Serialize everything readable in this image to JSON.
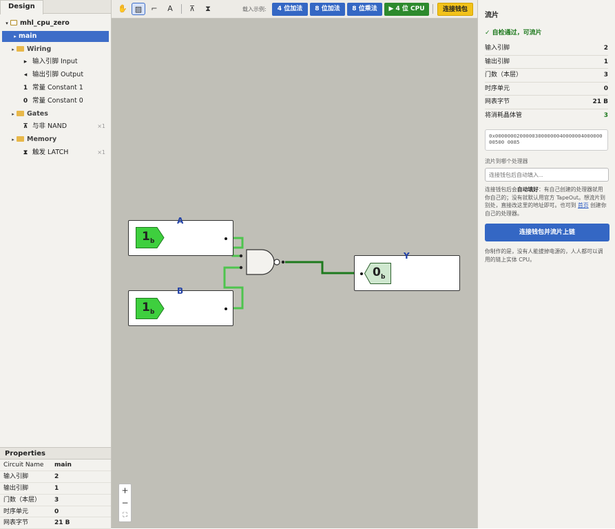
{
  "left": {
    "tab": "Design",
    "project": "mhl_cpu_zero",
    "tree": {
      "main": "main",
      "wiring": "Wiring",
      "input": "输入引脚 Input",
      "output": "输出引脚 Output",
      "const1_icon": "1",
      "const1": "常量 Constant 1",
      "const0_icon": "0",
      "const0": "常量 Constant 0",
      "gates": "Gates",
      "nand": "与非 NAND",
      "nand_count": "×1",
      "memory": "Memory",
      "latch": "触发 LATCH",
      "latch_count": "×1"
    },
    "properties": {
      "title": "Properties",
      "rows": [
        {
          "k": "Circuit Name",
          "v": "main"
        },
        {
          "k": "输入引脚",
          "v": "2"
        },
        {
          "k": "输出引脚",
          "v": "1"
        },
        {
          "k": "门数（本层）",
          "v": "3"
        },
        {
          "k": "时序单元",
          "v": "0"
        },
        {
          "k": "网表字节",
          "v": "21 B"
        }
      ]
    }
  },
  "toolbar": {
    "tool_text": "A",
    "load_label": "载入示例:",
    "examples": [
      "4 位加法",
      "8 位加法",
      "8 位乘法",
      "▶ 4 位 CPU"
    ],
    "connect": "连接钱包"
  },
  "circuit": {
    "input_a_label": "A",
    "input_a_value": "1",
    "input_a_sub": "b",
    "input_b_label": "B",
    "input_b_value": "1",
    "input_b_sub": "b",
    "output_y_label": "Y",
    "output_y_value": "0",
    "output_y_sub": "b"
  },
  "zoom": {
    "in": "+",
    "out": "−",
    "fit": "⛶"
  },
  "right": {
    "title": "流片",
    "status": "✓ 自检通过，可流片",
    "stats": [
      {
        "k": "输入引脚",
        "v": "2"
      },
      {
        "k": "输出引脚",
        "v": "1"
      },
      {
        "k": "门数（本层）",
        "v": "3"
      },
      {
        "k": "时序单元",
        "v": "0"
      },
      {
        "k": "网表字节",
        "v": "21 B"
      },
      {
        "k": "将消耗晶体管",
        "v": "3"
      }
    ],
    "hex": "0x0000000200000300000004000000400000000500 0085",
    "processor_label": "流片到哪个处理器",
    "processor_placeholder": "连接钱包后自动填入...",
    "para1_a": "连接钱包后会",
    "para1_b": "自动填好",
    "para1_c": "：有自己创建的处理器就用你自己的；没有就默认用官方 TapeOut。想流片到别处，直接改这里的地址即可。也可到",
    "para1_link": "首页",
    "para1_d": "创建你自己的处理器。",
    "button": "连接钱包并流片上链",
    "para2": "你制作的是，没有人能拔掉电源的，人人都可以调用的链上实体 CPU。"
  },
  "colors": {
    "accent": "#3467c4",
    "wire_on": "#4ec44e",
    "wire_dark": "#1e7a1e",
    "pin_fill": "#3ecf3e",
    "ok": "#1f7a1f",
    "cpu_button": "#2d8a2d",
    "connect_button": "#f2c21a"
  }
}
